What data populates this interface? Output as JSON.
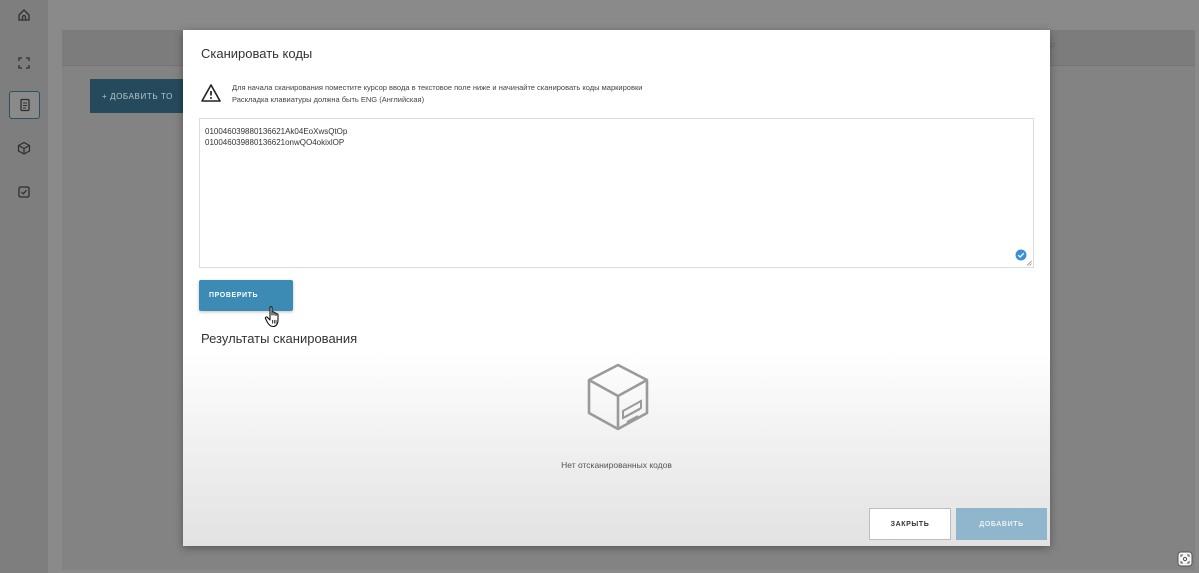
{
  "sidebar": {
    "icons": [
      "home-icon",
      "scan-frame-icon",
      "document-icon",
      "box-icon",
      "checklist-icon"
    ],
    "active_index": 2
  },
  "background": {
    "add_button_label": "+ ДОБАВИТЬ ТО",
    "hint_fragment": "Р"
  },
  "modal": {
    "title": "Сканировать коды",
    "warning": {
      "line1": "Для начала сканирования поместите курсор ввода в текстовое поле ниже и начинайте сканировать коды маркировки",
      "line2": "Раскладка клавиатуры должна быть ENG (Английская)"
    },
    "codes": [
      "010046039880136621Ak04EoXwsQtOp",
      "010046039880136621onwQO4okixlOP"
    ],
    "verify_label": "ПРОВЕРИТЬ",
    "results_title": "Результаты сканирования",
    "empty_text": "Нет отсканированных кодов",
    "close_label": "ЗАКРЫТЬ",
    "add_label": "ДОБАВИТЬ"
  },
  "colors": {
    "primary": "#3c8bb5",
    "primary_disabled": "#8fb6cc",
    "overlay": "#8a8a8a"
  }
}
